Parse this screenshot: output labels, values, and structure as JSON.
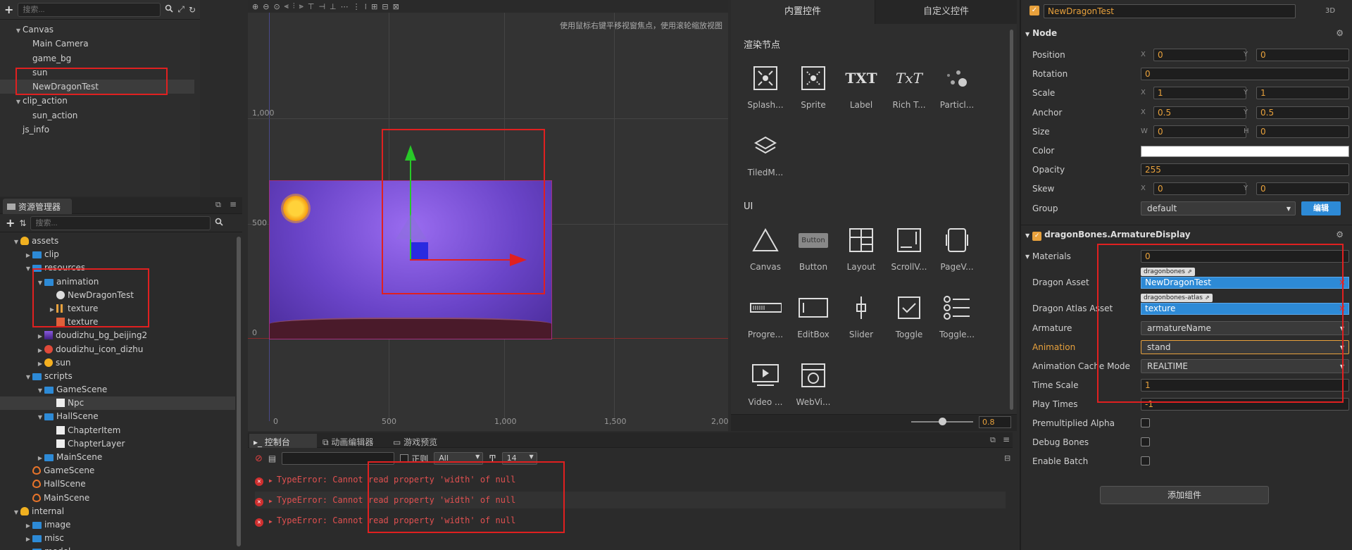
{
  "hierarchy": {
    "search_placeholder": "搜索...",
    "nodes": [
      {
        "label": "Canvas",
        "indent": 1,
        "arrow": "▼"
      },
      {
        "label": "Main Camera",
        "indent": 2,
        "arrow": ""
      },
      {
        "label": "game_bg",
        "indent": 2,
        "arrow": ""
      },
      {
        "label": "sun",
        "indent": 2,
        "arrow": ""
      },
      {
        "label": "NewDragonTest",
        "indent": 2,
        "arrow": "",
        "selected": true
      },
      {
        "label": "clip_action",
        "indent": 1,
        "arrow": "▼"
      },
      {
        "label": "sun_action",
        "indent": 2,
        "arrow": ""
      },
      {
        "label": "js_info",
        "indent": 1,
        "arrow": ""
      }
    ]
  },
  "assets": {
    "title": "资源管理器",
    "search_placeholder": "搜索...",
    "items": [
      {
        "label": "assets",
        "indent": 1,
        "arrow": "▼",
        "type": "db"
      },
      {
        "label": "clip",
        "indent": 2,
        "arrow": "▶",
        "type": "folder"
      },
      {
        "label": "resources",
        "indent": 2,
        "arrow": "▼",
        "type": "folder"
      },
      {
        "label": "animation",
        "indent": 3,
        "arrow": "▼",
        "type": "folder"
      },
      {
        "label": "NewDragonTest",
        "indent": 4,
        "arrow": "",
        "type": "dragon"
      },
      {
        "label": "texture",
        "indent": 4,
        "arrow": "▶",
        "type": "atlas"
      },
      {
        "label": "texture",
        "indent": 4,
        "arrow": "",
        "type": "image"
      },
      {
        "label": "doudizhu_bg_beijing2",
        "indent": 3,
        "arrow": "▶",
        "type": "bgimg"
      },
      {
        "label": "doudizhu_icon_dizhu",
        "indent": 3,
        "arrow": "▶",
        "type": "icon"
      },
      {
        "label": "sun",
        "indent": 3,
        "arrow": "▶",
        "type": "sun"
      },
      {
        "label": "scripts",
        "indent": 2,
        "arrow": "▼",
        "type": "folder"
      },
      {
        "label": "GameScene",
        "indent": 3,
        "arrow": "▼",
        "type": "folder"
      },
      {
        "label": "Npc",
        "indent": 4,
        "arrow": "",
        "type": "js",
        "selected": true
      },
      {
        "label": "HallScene",
        "indent": 3,
        "arrow": "▼",
        "type": "folder"
      },
      {
        "label": "ChapterItem",
        "indent": 4,
        "arrow": "",
        "type": "js"
      },
      {
        "label": "ChapterLayer",
        "indent": 4,
        "arrow": "",
        "type": "js"
      },
      {
        "label": "MainScene",
        "indent": 3,
        "arrow": "▶",
        "type": "folder"
      },
      {
        "label": "GameScene",
        "indent": 2,
        "arrow": "",
        "type": "scene"
      },
      {
        "label": "HallScene",
        "indent": 2,
        "arrow": "",
        "type": "scene"
      },
      {
        "label": "MainScene",
        "indent": 2,
        "arrow": "",
        "type": "scene"
      },
      {
        "label": "internal",
        "indent": 1,
        "arrow": "▼",
        "type": "db"
      },
      {
        "label": "image",
        "indent": 2,
        "arrow": "▶",
        "type": "folder"
      },
      {
        "label": "misc",
        "indent": 2,
        "arrow": "▶",
        "type": "folder"
      },
      {
        "label": "model",
        "indent": 2,
        "arrow": "▶",
        "type": "folder"
      }
    ]
  },
  "scene": {
    "hint": "使用鼠标右键平移视窗焦点，使用滚轮缩放视图",
    "y_labels": [
      "1,000",
      "500",
      "0"
    ],
    "x_labels": [
      "0",
      "500",
      "1,000",
      "1,500",
      "2,00"
    ]
  },
  "console": {
    "tabs": [
      "控制台",
      "动画编辑器",
      "游戏预览"
    ],
    "regex_label": "正则",
    "filter_value": "All",
    "font_size": "14",
    "errors": [
      "TypeError: Cannot read property 'width' of null",
      "TypeError: Cannot read property 'width' of null",
      "TypeError: Cannot read property 'width' of null"
    ]
  },
  "widgets": {
    "tabs": [
      "内置控件",
      "自定义控件"
    ],
    "render_title": "渲染节点",
    "render_items": [
      {
        "label": "Splash...",
        "icon": "splash-icon"
      },
      {
        "label": "Sprite",
        "icon": "sprite-icon"
      },
      {
        "label": "Label",
        "icon": "label-icon",
        "glyph": "TXT"
      },
      {
        "label": "Rich T...",
        "icon": "richtext-icon",
        "glyph": "TxT"
      },
      {
        "label": "Particl...",
        "icon": "particle-icon"
      },
      {
        "label": "TiledM...",
        "icon": "tiledmap-icon"
      }
    ],
    "ui_title": "UI",
    "ui_items": [
      {
        "label": "Canvas",
        "icon": "canvas-icon"
      },
      {
        "label": "Button",
        "icon": "button-icon",
        "glyph": "Button"
      },
      {
        "label": "Layout",
        "icon": "layout-icon"
      },
      {
        "label": "ScrollV...",
        "icon": "scrollview-icon"
      },
      {
        "label": "PageV...",
        "icon": "pageview-icon"
      },
      {
        "label": "Progre...",
        "icon": "progress-icon"
      },
      {
        "label": "EditBox",
        "icon": "editbox-icon"
      },
      {
        "label": "Slider",
        "icon": "slider-icon"
      },
      {
        "label": "Toggle",
        "icon": "toggle-icon"
      },
      {
        "label": "Toggle...",
        "icon": "togglegroup-icon"
      },
      {
        "label": "Video ...",
        "icon": "video-icon"
      },
      {
        "label": "WebVi...",
        "icon": "webview-icon"
      }
    ],
    "zoom_value": "0.8",
    "zoom_level": 0.5
  },
  "inspector": {
    "node_name": "NewDragonTest",
    "badge": "3D",
    "node_section": "Node",
    "props": {
      "position": {
        "label": "Position",
        "x": "0",
        "y": "0"
      },
      "rotation": {
        "label": "Rotation",
        "value": "0"
      },
      "scale": {
        "label": "Scale",
        "x": "1",
        "y": "1"
      },
      "anchor": {
        "label": "Anchor",
        "x": "0.5",
        "y": "0.5"
      },
      "size": {
        "label": "Size",
        "w": "0",
        "h": "0"
      },
      "color": {
        "label": "Color",
        "value": "#ffffff"
      },
      "opacity": {
        "label": "Opacity",
        "value": "255"
      },
      "skew": {
        "label": "Skew",
        "x": "0",
        "y": "0"
      },
      "group": {
        "label": "Group",
        "value": "default",
        "edit": "编辑"
      }
    },
    "axis": {
      "x": "X",
      "y": "Y",
      "w": "W",
      "h": "H"
    },
    "dragon_section": "dragonBones.ArmatureDisplay",
    "dragon": {
      "materials": {
        "label": "Materials",
        "value": "0"
      },
      "dragon_asset": {
        "label": "Dragon Asset",
        "tag": "dragonbones",
        "value": "NewDragonTest"
      },
      "dragon_atlas": {
        "label": "Dragon Atlas Asset",
        "tag": "dragonbones-atlas",
        "value": "texture"
      },
      "armature": {
        "label": "Armature",
        "value": "armatureName"
      },
      "animation": {
        "label": "Animation",
        "value": "stand"
      },
      "cache_mode": {
        "label": "Animation Cache Mode",
        "value": "REALTIME"
      },
      "time_scale": {
        "label": "Time Scale",
        "value": "1"
      },
      "play_times": {
        "label": "Play Times",
        "value": "-1"
      },
      "premultiplied": {
        "label": "Premultiplied Alpha"
      },
      "debug_bones": {
        "label": "Debug Bones"
      },
      "enable_batch": {
        "label": "Enable Batch"
      }
    },
    "add_component": "添加组件"
  },
  "colors": {
    "accent": "#2d8ad6",
    "highlight": "#e02020",
    "orange": "#e8a13c"
  }
}
